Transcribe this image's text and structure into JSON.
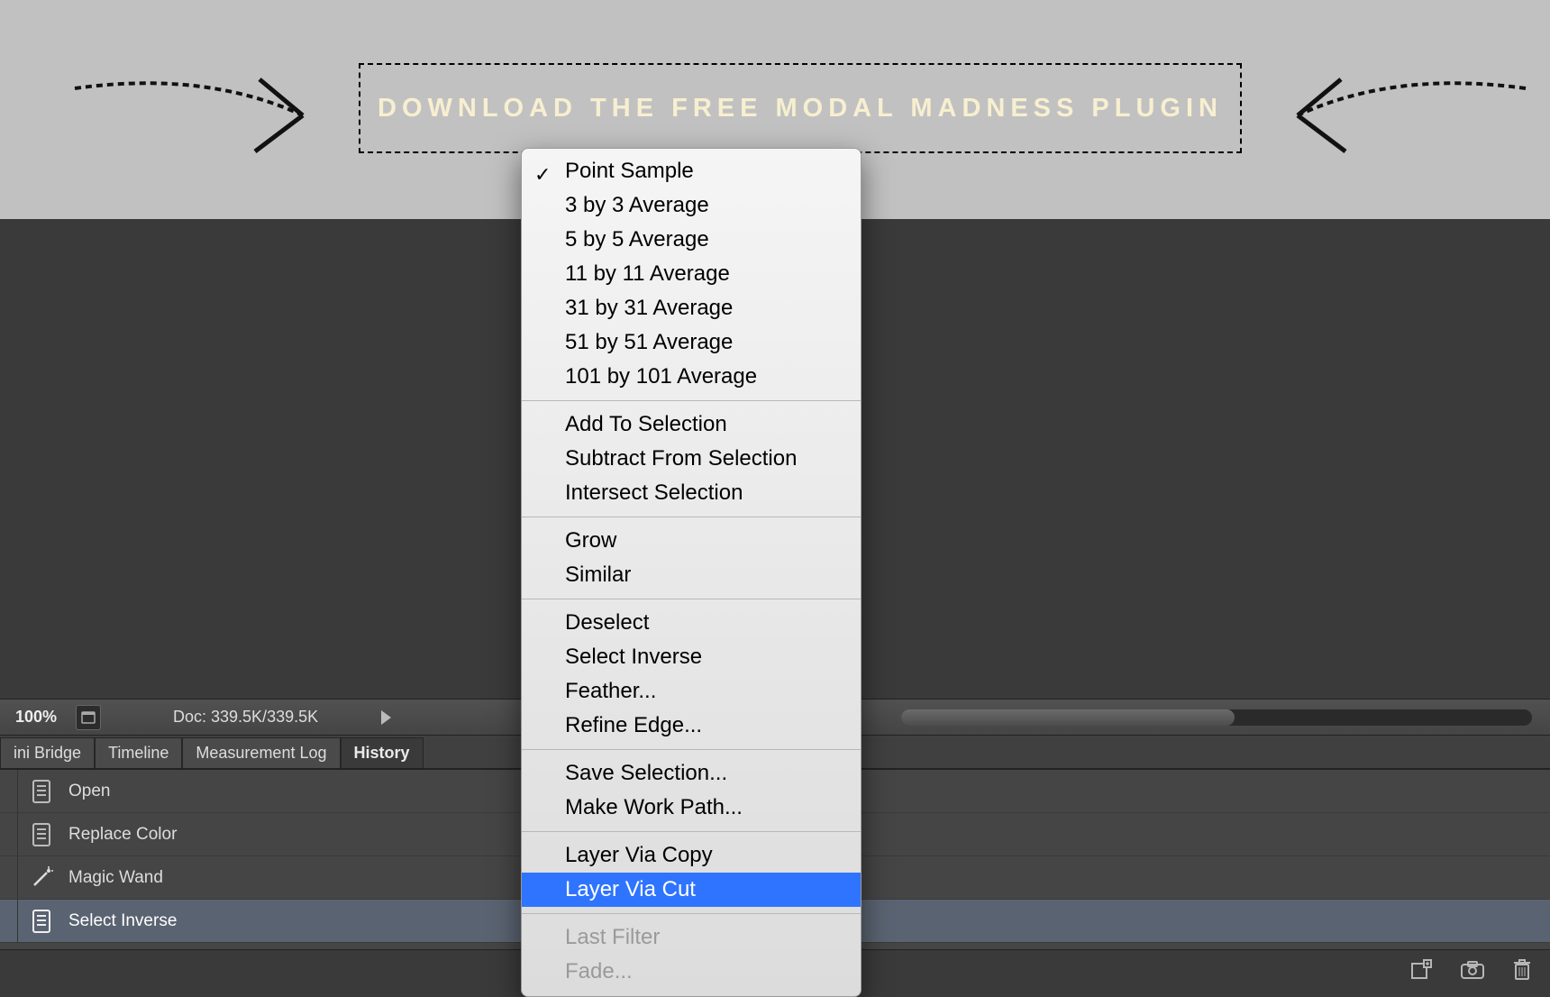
{
  "banner": {
    "text": "DOWNLOAD THE FREE MODAL MADNESS PLUGIN"
  },
  "status_bar": {
    "zoom": "100%",
    "doc_size": "Doc: 339.5K/339.5K"
  },
  "panel_tabs": {
    "items": [
      {
        "label": "ini Bridge",
        "active": false
      },
      {
        "label": "Timeline",
        "active": false
      },
      {
        "label": "Measurement Log",
        "active": false
      },
      {
        "label": "History",
        "active": true
      }
    ]
  },
  "history": {
    "rows": [
      {
        "label": "Open",
        "icon": "document-icon",
        "selected": false
      },
      {
        "label": "Replace Color",
        "icon": "document-icon",
        "selected": false
      },
      {
        "label": "Magic Wand",
        "icon": "wand-icon",
        "selected": false
      },
      {
        "label": "Select Inverse",
        "icon": "document-icon",
        "selected": true
      }
    ]
  },
  "context_menu": {
    "groups": [
      [
        {
          "label": "Point Sample",
          "checked": true
        },
        {
          "label": "3 by 3 Average"
        },
        {
          "label": "5 by 5 Average"
        },
        {
          "label": "11 by 11 Average"
        },
        {
          "label": "31 by 31 Average"
        },
        {
          "label": "51 by 51 Average"
        },
        {
          "label": "101 by 101 Average"
        }
      ],
      [
        {
          "label": "Add To Selection"
        },
        {
          "label": "Subtract From Selection"
        },
        {
          "label": "Intersect Selection"
        }
      ],
      [
        {
          "label": "Grow"
        },
        {
          "label": "Similar"
        }
      ],
      [
        {
          "label": "Deselect"
        },
        {
          "label": "Select Inverse"
        },
        {
          "label": "Feather..."
        },
        {
          "label": "Refine Edge..."
        }
      ],
      [
        {
          "label": "Save Selection..."
        },
        {
          "label": "Make Work Path..."
        }
      ],
      [
        {
          "label": "Layer Via Copy"
        },
        {
          "label": "Layer Via Cut",
          "highlight": true
        }
      ],
      [
        {
          "label": "Last Filter",
          "disabled": true
        },
        {
          "label": "Fade...",
          "disabled": true
        }
      ]
    ]
  },
  "panel_footer_icons": [
    "new-document-from-state-icon",
    "snapshot-icon",
    "trash-icon"
  ]
}
